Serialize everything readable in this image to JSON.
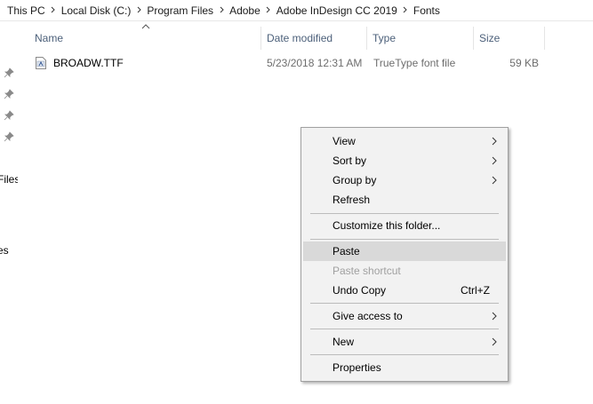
{
  "breadcrumb": {
    "items": [
      "This PC",
      "Local Disk (C:)",
      "Program Files",
      "Adobe",
      "Adobe InDesign CC 2019",
      "Fonts"
    ]
  },
  "nav": {
    "labels": [
      "Files",
      "es"
    ]
  },
  "columns": {
    "name": "Name",
    "date_modified": "Date modified",
    "type": "Type",
    "size": "Size"
  },
  "files": [
    {
      "name": "BROADW.TTF",
      "date_modified": "5/23/2018 12:31 AM",
      "type": "TrueType font file",
      "size": "59 KB"
    }
  ],
  "context_menu": {
    "view": "View",
    "sort_by": "Sort by",
    "group_by": "Group by",
    "refresh": "Refresh",
    "customize": "Customize this folder...",
    "paste": "Paste",
    "paste_shortcut": "Paste shortcut",
    "undo_copy": "Undo Copy",
    "undo_copy_shortcut": "Ctrl+Z",
    "give_access": "Give access to",
    "new": "New",
    "properties": "Properties"
  },
  "colors": {
    "menu_background": "#f2f2f2",
    "menu_highlight": "#d9d9d9",
    "header_text": "#4c607a",
    "disabled_text": "#a0a0a0"
  }
}
